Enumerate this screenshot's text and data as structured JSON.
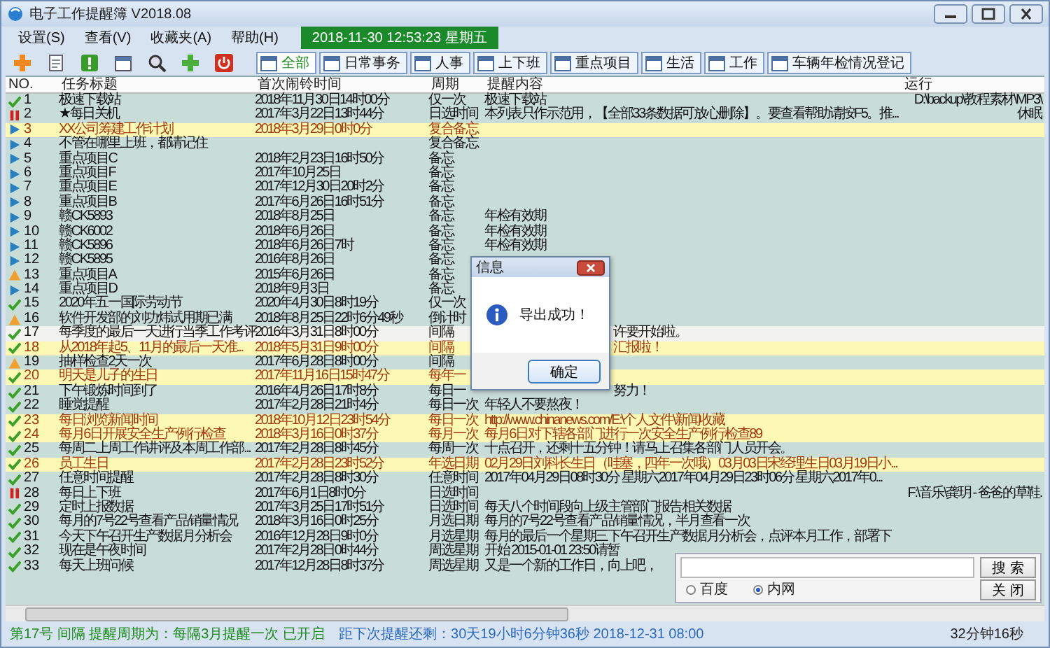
{
  "window": {
    "title": "电子工作提醒簿 V2018.08"
  },
  "menu": [
    "设置(S)",
    "查看(V)",
    "收藏夹(A)",
    "帮助(H)"
  ],
  "clock": "2018-11-30 12:53:23  星期五",
  "filters": [
    {
      "label": "全部",
      "selected": true
    },
    {
      "label": "日常事务",
      "selected": false
    },
    {
      "label": "人事",
      "selected": false
    },
    {
      "label": "上下班",
      "selected": false
    },
    {
      "label": "重点项目",
      "selected": false
    },
    {
      "label": "生活",
      "selected": false
    },
    {
      "label": "工作",
      "selected": false
    },
    {
      "label": "车辆年检情况登记",
      "selected": false
    }
  ],
  "table": {
    "columns": [
      "NO.",
      "任务标题",
      "首次闹铃时间",
      "周期",
      "提醒内容",
      "运行"
    ],
    "rows": [
      {
        "kind": "done",
        "no": "1",
        "title": "极速下载站",
        "time": "2018年11月30日14时00分",
        "period": "仅一次",
        "content": "极速下载站",
        "run": "D:\\backup\\教程素材\\MP3\\",
        "highlighted": false,
        "selected": false
      },
      {
        "kind": "paused",
        "no": "2",
        "title": "★每日关机",
        "time": "2017年3月22日13时44分",
        "period": "日选时间",
        "content": "本列表只作示范用，【全部33条数据可放心删除】。要查看帮助请按F5。推...",
        "run": "休眠",
        "highlighted": false,
        "selected": false
      },
      {
        "kind": "memo",
        "no": "3",
        "title": "XX公司筹建工作计划",
        "time": "2018年3月29日0时0分",
        "period": "复合备忘",
        "highlighted": true,
        "selected": false
      },
      {
        "kind": "memo",
        "no": "4",
        "title": "不管在哪里上班，都请记住",
        "period": "复合备忘",
        "highlighted": false,
        "selected": false
      },
      {
        "kind": "memo",
        "no": "5",
        "title": "重点项目C",
        "time": "2018年2月23日16时50分",
        "period": "备忘",
        "highlighted": false,
        "selected": false
      },
      {
        "kind": "memo",
        "no": "6",
        "title": "重点项目F",
        "time": "2017年10月25日",
        "period": "备忘",
        "highlighted": false,
        "selected": false
      },
      {
        "kind": "memo",
        "no": "7",
        "title": "重点项目E",
        "time": "2017年12月30日20时2分",
        "period": "备忘",
        "highlighted": false,
        "selected": false
      },
      {
        "kind": "memo",
        "no": "8",
        "title": "重点项目B",
        "time": "2017年6月26日16时51分",
        "period": "备忘",
        "highlighted": false,
        "selected": false
      },
      {
        "kind": "memo",
        "no": "9",
        "title": "赣CK5893",
        "time": "2018年8月25日",
        "period": "备忘",
        "content": "年检有效期",
        "highlighted": false,
        "selected": false
      },
      {
        "kind": "memo",
        "no": "10",
        "title": "赣CK6002",
        "time": "2018年6月26日",
        "period": "备忘",
        "content": "年检有效期",
        "highlighted": false,
        "selected": false
      },
      {
        "kind": "memo",
        "no": "11",
        "title": "赣CK5896",
        "time": "2018年6月26日7时",
        "period": "备忘",
        "content": "年检有效期",
        "highlighted": false,
        "selected": false
      },
      {
        "kind": "memo",
        "no": "12",
        "title": "赣CK5895",
        "time": "2016年8月26日",
        "period": "备忘",
        "highlighted": false,
        "selected": false
      },
      {
        "kind": "warning",
        "no": "13",
        "title": "重点项目A",
        "time": "2015年6月26日",
        "period": "备忘",
        "highlighted": false,
        "selected": false
      },
      {
        "kind": "memo",
        "no": "14",
        "title": "重点项目D",
        "time": "2018年9月3日",
        "period": "备忘",
        "highlighted": false,
        "selected": false
      },
      {
        "kind": "done",
        "no": "15",
        "title": "2020年五一国际劳动节",
        "time": "2020年4月30日8时19分",
        "period": "仅一次",
        "highlighted": false,
        "selected": false
      },
      {
        "kind": "warning",
        "no": "16",
        "title": "软件开发部的刘功炜试用期已满",
        "time": "2018年8月25日22时6分49秒",
        "period": "倒计时",
        "highlighted": false,
        "selected": false
      },
      {
        "kind": "done",
        "no": "17",
        "title": "每季度的最后一天进行当季工作考评",
        "time": "2016年3月31日8时00分",
        "period": "间隔",
        "content_tail": "许要开始啦。",
        "highlighted": false,
        "selected": true
      },
      {
        "kind": "done",
        "no": "18",
        "title": "从2018年起5、11月的最后一天准...",
        "time": "2018年5月31日9时00分",
        "period": "间隔",
        "content_tail": "汇报啦！",
        "highlighted": true,
        "selected": false
      },
      {
        "kind": "warning",
        "no": "19",
        "title": "抽样检查2天一次",
        "time": "2017年6月28日8时00分",
        "period": "间隔",
        "highlighted": false,
        "selected": false
      },
      {
        "kind": "done",
        "no": "20",
        "title": "明天是儿子的生日",
        "time": "2017年11月16日15时47分",
        "period": "每年一",
        "highlighted": true,
        "selected": false
      },
      {
        "kind": "done",
        "no": "21",
        "title": "下午锻炼时间到了",
        "time": "2016年4月26日17时8分",
        "period": "每日一",
        "content_tail": "努力！",
        "highlighted": false,
        "selected": false
      },
      {
        "kind": "done",
        "no": "22",
        "title": "睡觉提醒",
        "time": "2017年2月28日21时4分",
        "period": "每日一次",
        "content": "年轻人不要熬夜！",
        "highlighted": false,
        "selected": false
      },
      {
        "kind": "done",
        "no": "23",
        "title": "每日浏览新闻时间",
        "time": "2018年10月12日23时54分",
        "period": "每日一次",
        "content": "http://www.chinanews.com/E:\\个人文件\\新闻收藏",
        "highlighted": true,
        "selected": false
      },
      {
        "kind": "done",
        "no": "24",
        "title": "每月6日开展安全生产例行检查",
        "time": "2018年3月16日0时37分",
        "period": "每月一次",
        "content": "每月6日对下辖各部门进行一次安全生产例行检查89",
        "highlighted": true,
        "selected": false
      },
      {
        "kind": "done",
        "no": "25",
        "title": "每周二上周工作讲评及本周工作部...",
        "time": "2017年2月28日8时45分",
        "period": "每周一次",
        "content": "十点召开，还剩十五分钟！请马上召集各部门人员开会。",
        "highlighted": false,
        "selected": false
      },
      {
        "kind": "done",
        "no": "26",
        "title": "员工生日",
        "time": "2017年2月28日23时52分",
        "period": "年选日期",
        "content": "02月29日刘科长生日（哇塞，四年一次哦）03月03日宋经理生日03月19日小...",
        "highlighted": true,
        "selected": false
      },
      {
        "kind": "done",
        "no": "27",
        "title": "任意时间提醒",
        "time": "2017年2月28日8时30分",
        "period": "任意时间",
        "content": "2017年04月29日08时30分 星期六2017年04月29日23时06分 星期六2017年0...",
        "highlighted": false,
        "selected": false
      },
      {
        "kind": "paused",
        "no": "28",
        "title": "每日上下班",
        "time": "2017年6月1日8时0分",
        "period": "日选时间",
        "run": "F:\\音乐\\龚玥 - 爸爸的草鞋.",
        "highlighted": false,
        "selected": false
      },
      {
        "kind": "done",
        "no": "29",
        "title": "定时上报数据",
        "time": "2017年3月25日17时51分",
        "period": "日选时间",
        "content": "每天八个时间段向上级主管部门报告相关数据",
        "highlighted": false,
        "selected": false
      },
      {
        "kind": "done",
        "no": "30",
        "title": "每月的7号22号查看产品销量情况",
        "time": "2018年3月16日0时25分",
        "period": "月选日期",
        "content": "每月的7号22号查看产品销量情况，半月查看一次",
        "highlighted": false,
        "selected": false
      },
      {
        "kind": "done",
        "no": "31",
        "title": "今天下午召开生产数据月分析会",
        "time": "2016年12月28日9时0分",
        "period": "月选星期",
        "content": "每月的最后一个星期三下午召开生产数据月分析会，点评本月工作，部署下",
        "highlighted": false,
        "selected": false
      },
      {
        "kind": "done",
        "no": "32",
        "title": "现在是午夜时间",
        "time": "2017年2月28日0时44分",
        "period": "周选星期",
        "content": "开始 2015-01-01 23:50请暂",
        "highlighted": false,
        "selected": false
      },
      {
        "kind": "done",
        "no": "33",
        "title": "每天上班问候",
        "time": "2017年12月28日8时37分",
        "period": "周选星期",
        "content": "又是一个新的工作日，向上吧，",
        "highlighted": false,
        "selected": false
      }
    ]
  },
  "dialog": {
    "title": "信息",
    "message": "导出成功！",
    "button": "确定"
  },
  "search_panel": {
    "search_button": "搜 索",
    "close_button": "关 闭",
    "engines": [
      {
        "label": "百度",
        "selected": false
      },
      {
        "label": "内网",
        "selected": true
      }
    ]
  },
  "status_bar": {
    "task": "第17号 间隔 提醒周期为：每隔3月提醒一次 已开启",
    "next": "距下次提醒还剩：30天19小时6分钟36秒 2018-12-31 08:00",
    "elapsed": "32分钟16秒"
  }
}
